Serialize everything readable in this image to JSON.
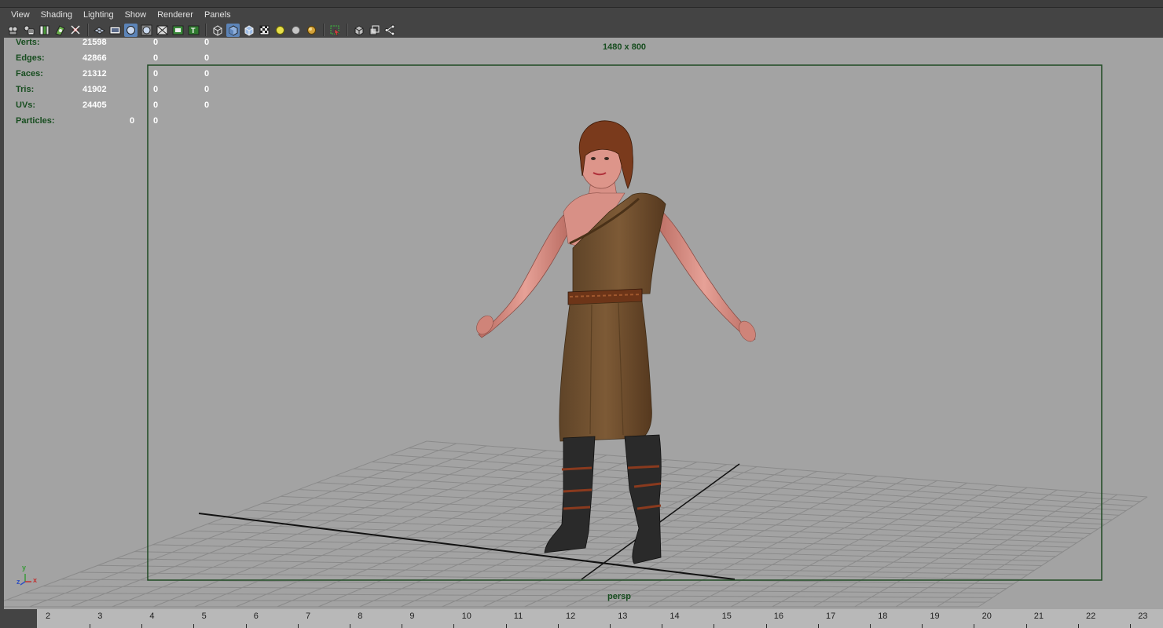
{
  "menubar": {
    "items": [
      {
        "id": "view",
        "label": "View"
      },
      {
        "id": "shading",
        "label": "Shading"
      },
      {
        "id": "lighting",
        "label": "Lighting"
      },
      {
        "id": "show",
        "label": "Show"
      },
      {
        "id": "renderer",
        "label": "Renderer"
      },
      {
        "id": "panels",
        "label": "Panels"
      }
    ]
  },
  "toolbar": {
    "groups": [
      [
        "select-camera-icon",
        "camera-attributes-icon",
        "bookmarks-icon",
        "image-plane-icon",
        "2d-pan-zoom-icon"
      ],
      [
        "grid-icon",
        "film-gate-icon",
        "resolution-gate-icon",
        "gate-mask-icon",
        "field-chart-icon",
        "safe-action-icon",
        "safe-title-icon"
      ],
      [
        "wireframe-icon",
        "smooth-shade-icon",
        "wireframe-on-shaded-icon",
        "textured-icon",
        "default-lighting-icon",
        "all-lights-icon",
        "shadows-icon"
      ],
      [
        "isolate-select-icon"
      ],
      [
        "xray-icon",
        "xray-joints-icon",
        "xray-components-icon"
      ]
    ]
  },
  "hud": {
    "rows": [
      {
        "label": "Verts:",
        "values": [
          "21598",
          "0",
          "0"
        ]
      },
      {
        "label": "Edges:",
        "values": [
          "42866",
          "0",
          "0"
        ]
      },
      {
        "label": "Faces:",
        "values": [
          "21312",
          "0",
          "0"
        ]
      },
      {
        "label": "Tris:",
        "values": [
          "41902",
          "0",
          "0"
        ]
      },
      {
        "label": "UVs:",
        "values": [
          "24405",
          "0",
          "0"
        ]
      },
      {
        "label": "Particles:",
        "values": [
          "0",
          "0"
        ]
      }
    ]
  },
  "viewport": {
    "resolution_label": "1480 x 800",
    "camera_label": "persp",
    "axis_labels": {
      "x": "x",
      "y": "y",
      "z": "z"
    }
  },
  "timeline": {
    "frames": [
      "2",
      "3",
      "4",
      "5",
      "6",
      "7",
      "8",
      "9",
      "10",
      "11",
      "12",
      "13",
      "14",
      "15",
      "16",
      "17",
      "18",
      "19",
      "20",
      "21",
      "22",
      "23"
    ]
  },
  "colors": {
    "viewport_bg": "#a3a3a3",
    "hud_label": "#174d1f",
    "hud_value": "#ffffff",
    "gate_border": "#1e4a22",
    "ui_bg": "#444444",
    "timeline_bg": "#b8b8b8"
  }
}
